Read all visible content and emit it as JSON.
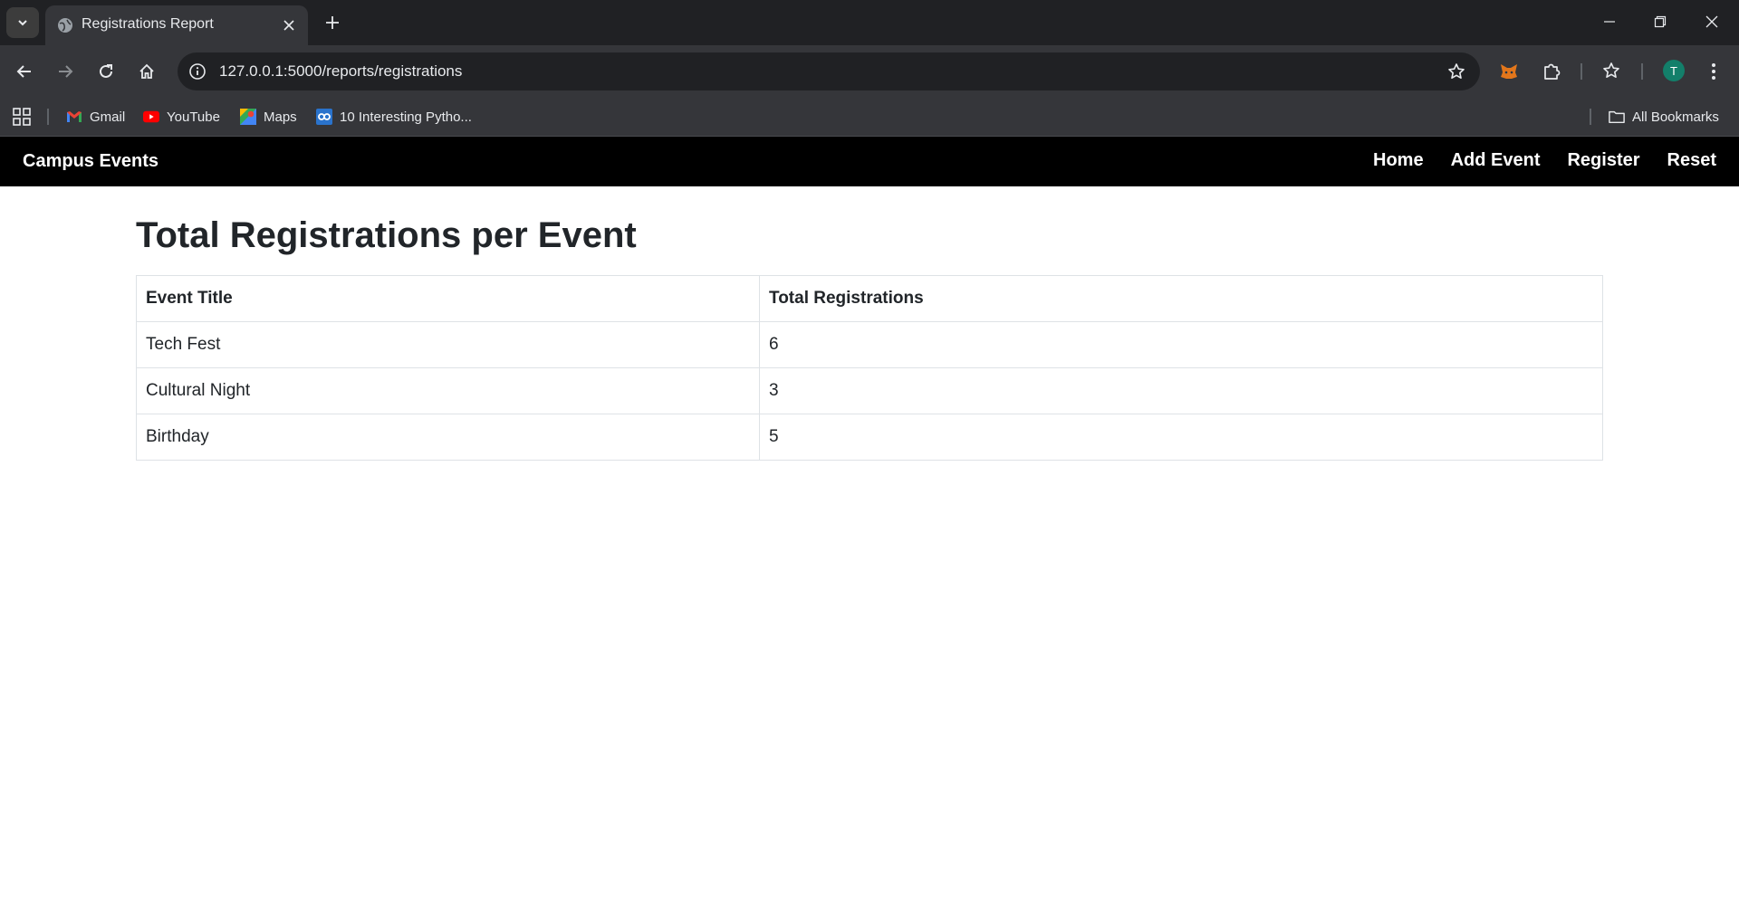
{
  "browser": {
    "tab_title": "Registrations Report",
    "url": "127.0.0.1:5000/reports/registrations",
    "avatar_initial": "T",
    "bookmarks": [
      {
        "label": "Gmail",
        "icon": "gmail-icon"
      },
      {
        "label": "YouTube",
        "icon": "youtube-icon"
      },
      {
        "label": "Maps",
        "icon": "maps-icon"
      },
      {
        "label": "10 Interesting Pytho...",
        "icon": "coursera-icon"
      }
    ],
    "all_bookmarks_label": "All Bookmarks"
  },
  "site": {
    "brand": "Campus Events",
    "nav": [
      "Home",
      "Add Event",
      "Register",
      "Reset"
    ]
  },
  "report": {
    "title": "Total Registrations per Event",
    "columns": [
      "Event Title",
      "Total Registrations"
    ],
    "rows": [
      [
        "Tech Fest",
        "6"
      ],
      [
        "Cultural Night",
        "3"
      ],
      [
        "Birthday",
        "5"
      ]
    ]
  },
  "colors": {
    "navbar": "#000000",
    "chrome_dark": "#202124",
    "chrome_toolbar": "#35363a",
    "table_border": "#dee2e6",
    "text": "#212529"
  }
}
